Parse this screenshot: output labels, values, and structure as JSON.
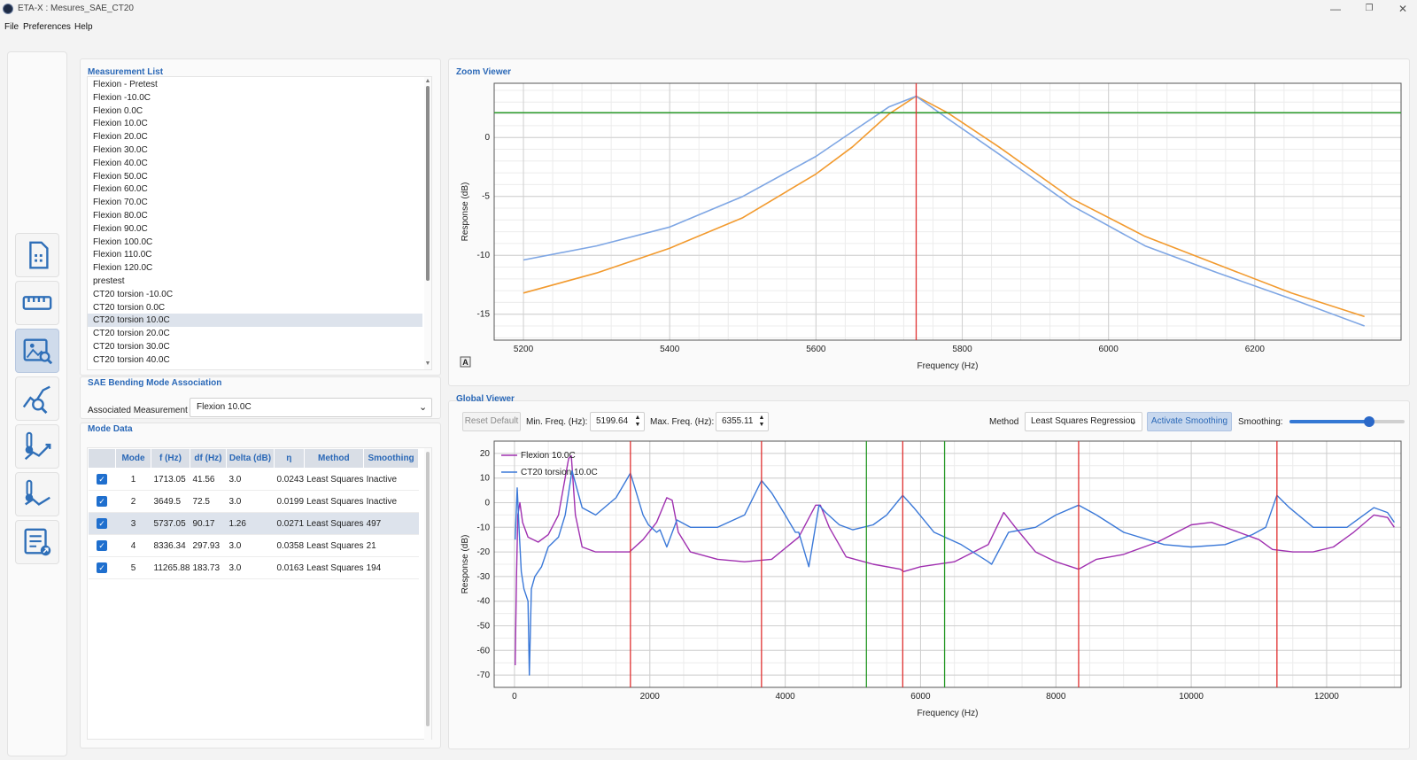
{
  "window": {
    "title": "ETA-X : Mesures_SAE_CT20",
    "minimize": "—",
    "maximize": "❐",
    "close": "✕"
  },
  "menu": [
    "File",
    "Preferences",
    "Help"
  ],
  "sidebar": {
    "items": [
      {
        "icon": "sim-card-icon",
        "active": false
      },
      {
        "icon": "ruler-icon",
        "active": false
      },
      {
        "icon": "image-search-icon",
        "active": true
      },
      {
        "icon": "chart-search-icon",
        "active": false
      },
      {
        "icon": "temperature-trend-up-icon",
        "active": false
      },
      {
        "icon": "temperature-trend-down-icon",
        "active": false
      },
      {
        "icon": "report-export-icon",
        "active": false
      }
    ]
  },
  "measurement_list": {
    "title": "Measurement List",
    "selected": 18,
    "items": [
      "Flexion - Pretest",
      "Flexion  -10.0C",
      "Flexion 0.0C",
      "Flexion 10.0C",
      "Flexion 20.0C",
      "Flexion 30.0C",
      "Flexion 40.0C",
      "Flexion 50.0C",
      "Flexion 60.0C",
      "Flexion 70.0C",
      "Flexion 80.0C",
      "Flexion 90.0C",
      "Flexion 100.0C",
      "Flexion 110.0C",
      "Flexion 120.0C",
      "prestest",
      "CT20 torsion -10.0C",
      "CT20 torsion 0.0C",
      "CT20 torsion 10.0C",
      "CT20 torsion 20.0C",
      "CT20 torsion 30.0C",
      "CT20 torsion 40.0C"
    ]
  },
  "association": {
    "title": "SAE Bending Mode Association",
    "label": "Associated Measurement",
    "value": "Flexion 10.0C"
  },
  "mode_data": {
    "title": "Mode Data",
    "columns": [
      "",
      "Mode",
      "f (Hz)",
      "df (Hz)",
      "Delta (dB)",
      "η",
      "Method",
      "Smoothing"
    ],
    "selected_row": 2,
    "rows": [
      {
        "checked": true,
        "mode": "1",
        "f": "1713.05",
        "df": "41.56",
        "delta": "3.0",
        "eta": "0.0243",
        "method": "Least Squares",
        "smoothing": "Inactive"
      },
      {
        "checked": true,
        "mode": "2",
        "f": "3649.5",
        "df": "72.5",
        "delta": "3.0",
        "eta": "0.0199",
        "method": "Least Squares",
        "smoothing": "Inactive"
      },
      {
        "checked": true,
        "mode": "3",
        "f": "5737.05",
        "df": "90.17",
        "delta": "1.26",
        "eta": "0.0271",
        "method": "Least Squares",
        "smoothing": "497"
      },
      {
        "checked": true,
        "mode": "4",
        "f": "8336.34",
        "df": "297.93",
        "delta": "3.0",
        "eta": "0.0358",
        "method": "Least Squares",
        "smoothing": "21"
      },
      {
        "checked": true,
        "mode": "5",
        "f": "11265.88",
        "df": "183.73",
        "delta": "3.0",
        "eta": "0.0163",
        "method": "Least Squares",
        "smoothing": "194"
      }
    ]
  },
  "zoom_viewer": {
    "title": "Zoom Viewer",
    "autoscale_label": "A"
  },
  "global_viewer": {
    "title": "Global Viewer",
    "reset_label": "Reset Default",
    "min_label": "Min. Freq. (Hz):",
    "min_value": "5199.64",
    "max_label": "Max. Freq. (Hz):",
    "max_value": "6355.11",
    "method_label": "Method",
    "method_value": "Least Squares Regression",
    "smoothing_button": "Activate Smoothing",
    "smoothing_label": "Smoothing:",
    "smoothing_level": 0.69
  },
  "chart_data": [
    {
      "type": "line",
      "title": "",
      "xlabel": "Frequency (Hz)",
      "ylabel": "Response (dB)",
      "xlim": [
        5160,
        6400
      ],
      "ylim": [
        -17.2,
        4.6
      ],
      "xticks": [
        5200,
        5400,
        5600,
        5800,
        6000,
        6200
      ],
      "yticks": [
        0,
        -5,
        -10,
        -15
      ],
      "vlines": [
        {
          "x": 5737,
          "color": "#e03030"
        }
      ],
      "hlines": [
        {
          "y": 2.1,
          "color": "#2a9a2a"
        }
      ],
      "series": [
        {
          "color": "#f29a2e",
          "x": [
            5200,
            5300,
            5400,
            5500,
            5600,
            5650,
            5700,
            5737,
            5780,
            5850,
            5950,
            6050,
            6150,
            6250,
            6350
          ],
          "y": [
            -13.2,
            -11.5,
            -9.4,
            -6.8,
            -3.1,
            -0.8,
            2.0,
            3.5,
            2.1,
            -0.8,
            -5.2,
            -8.4,
            -10.8,
            -13.2,
            -15.2
          ]
        },
        {
          "color": "#7ea6e4",
          "x": [
            5200,
            5300,
            5400,
            5500,
            5600,
            5650,
            5700,
            5737,
            5780,
            5850,
            5950,
            6050,
            6150,
            6250,
            6350
          ],
          "y": [
            -10.4,
            -9.2,
            -7.6,
            -5.0,
            -1.6,
            0.5,
            2.6,
            3.5,
            1.6,
            -1.4,
            -5.8,
            -9.2,
            -11.5,
            -13.7,
            -16.0
          ]
        }
      ]
    },
    {
      "type": "line",
      "title": "",
      "xlabel": "Frequency (Hz)",
      "ylabel": "Response (dB)",
      "xlim": [
        -300,
        13100
      ],
      "ylim": [
        -75,
        25
      ],
      "xticks": [
        0,
        2000,
        4000,
        6000,
        8000,
        10000,
        12000
      ],
      "yticks": [
        20,
        10,
        0,
        -10,
        -20,
        -30,
        -40,
        -50,
        -60,
        -70
      ],
      "legend": "top-left",
      "vlines": [
        {
          "x": 1713,
          "color": "#e03030"
        },
        {
          "x": 3650,
          "color": "#e03030"
        },
        {
          "x": 5737,
          "color": "#e03030"
        },
        {
          "x": 8336,
          "color": "#e03030"
        },
        {
          "x": 11266,
          "color": "#e03030"
        },
        {
          "x": 5200,
          "color": "#2a9a2a"
        },
        {
          "x": 6355,
          "color": "#2a9a2a"
        }
      ],
      "series": [
        {
          "name": "Flexion 10.0C",
          "color": "#a030b0",
          "x": [
            10,
            30,
            50,
            80,
            120,
            200,
            350,
            500,
            650,
            800,
            840,
            900,
            1000,
            1200,
            1500,
            1700,
            1900,
            2100,
            2250,
            2330,
            2420,
            2600,
            3000,
            3400,
            3800,
            4200,
            4450,
            4520,
            4650,
            4900,
            5300,
            5700,
            5750,
            6000,
            6500,
            7000,
            7230,
            7400,
            7700,
            8000,
            8336,
            8600,
            9000,
            9500,
            10000,
            10300,
            10700,
            11000,
            11200,
            11500,
            11800,
            12100,
            12400,
            12700,
            12900,
            13000
          ],
          "y": [
            -66,
            -30,
            -5,
            0,
            -8,
            -14,
            -16,
            -13,
            -5,
            18,
            19,
            -5,
            -18,
            -20,
            -20,
            -20,
            -15,
            -8,
            2,
            1,
            -12,
            -20,
            -23,
            -24,
            -23,
            -14,
            -1,
            -1,
            -10,
            -22,
            -25,
            -27,
            -28,
            -26,
            -24,
            -17,
            -4,
            -10,
            -20,
            -24,
            -27,
            -23,
            -21,
            -16,
            -9,
            -8,
            -12,
            -15,
            -19,
            -20,
            -20,
            -18,
            -12,
            -5,
            -6,
            -10
          ]
        },
        {
          "name": "CT20 torsion 10.0C",
          "color": "#3a78d8",
          "x": [
            10,
            40,
            70,
            100,
            140,
            200,
            220,
            250,
            300,
            400,
            500,
            650,
            750,
            850,
            900,
            1000,
            1200,
            1500,
            1650,
            1713,
            1780,
            1900,
            1980,
            2100,
            2150,
            2250,
            2400,
            2600,
            3000,
            3400,
            3650,
            3800,
            4000,
            4150,
            4200,
            4350,
            4500,
            4600,
            4800,
            5000,
            5300,
            5500,
            5737,
            5900,
            6200,
            6600,
            7000,
            7050,
            7300,
            7700,
            8000,
            8336,
            8600,
            9000,
            9600,
            10000,
            10500,
            10900,
            11100,
            11266,
            11450,
            11800,
            12300,
            12700,
            12900,
            13000
          ],
          "y": [
            -15,
            6,
            -12,
            -28,
            -35,
            -40,
            -70,
            -35,
            -30,
            -26,
            -18,
            -14,
            -5,
            13,
            8,
            -2,
            -5,
            2,
            9,
            12,
            6,
            -5,
            -9,
            -12,
            -11,
            -18,
            -7,
            -10,
            -10,
            -5,
            9,
            4,
            -5,
            -12,
            -12,
            -26,
            -1,
            -4,
            -9,
            -11,
            -9,
            -5,
            3,
            -2,
            -12,
            -17,
            -24,
            -25,
            -12,
            -10,
            -5,
            -1,
            -5,
            -12,
            -17,
            -18,
            -17,
            -13,
            -10,
            3,
            -2,
            -10,
            -10,
            -2,
            -4,
            -8
          ]
        }
      ]
    }
  ]
}
